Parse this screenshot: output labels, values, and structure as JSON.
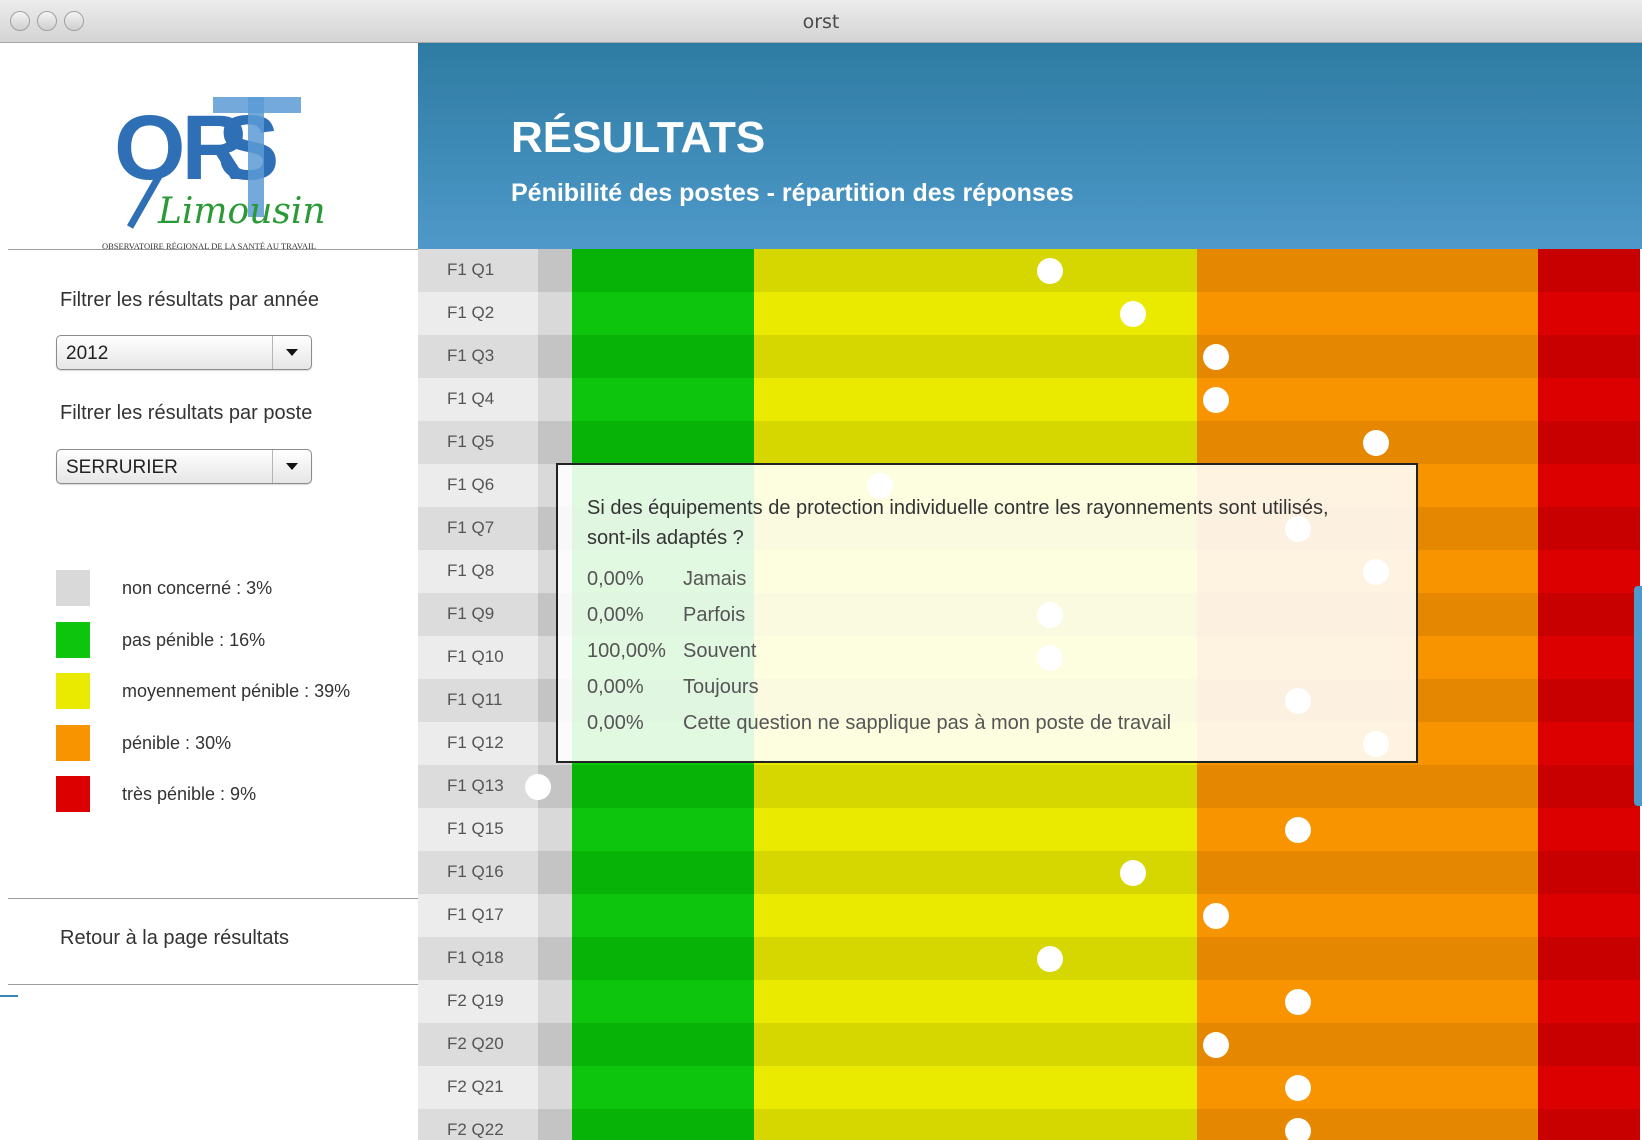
{
  "window": {
    "title": "orst"
  },
  "logo": {
    "letters": "ORST",
    "subtitle": "Limousin",
    "tagline": "Observatoire Régional de la Santé au Travail"
  },
  "sidebar": {
    "year_filter_label": "Filtrer les résultats par année",
    "year_value": "2012",
    "post_filter_label": "Filtrer les résultats par poste",
    "post_value": "SERRURIER",
    "legend": [
      {
        "label": "non concerné : 3%",
        "color": "#d9d9d9"
      },
      {
        "label": "pas pénible : 16%",
        "color": "#0cc50c"
      },
      {
        "label": "moyennement pénible : 39%",
        "color": "#eaea00"
      },
      {
        "label": "pénible : 30%",
        "color": "#f79400"
      },
      {
        "label": "très pénible : 9%",
        "color": "#dc0000"
      }
    ],
    "back_link": "Retour à la page résultats"
  },
  "header": {
    "title": "RÉSULTATS",
    "subtitle": "Pénibilité des postes - répartition des réponses"
  },
  "chart_data": {
    "type": "heatmap",
    "categories_y": [
      "F1 Q1",
      "F1 Q2",
      "F1 Q3",
      "F1 Q4",
      "F1 Q5",
      "F1 Q6",
      "F1 Q7",
      "F1 Q8",
      "F1 Q9",
      "F1 Q10",
      "F1 Q11",
      "F1 Q12",
      "F1 Q13",
      "F1 Q15",
      "F1 Q16",
      "F1 Q17",
      "F1 Q18",
      "F2 Q19",
      "F2 Q20",
      "F2 Q21",
      "F2 Q22"
    ],
    "bands": [
      {
        "name": "non concerné",
        "share": 3,
        "color": "#d9d9d9",
        "color_alt": "#c4c4c4"
      },
      {
        "name": "pas pénible",
        "share": 16,
        "color": "#0cc50c",
        "color_alt": "#07b307"
      },
      {
        "name": "moyennement pénible",
        "share": 39,
        "color": "#eaea00",
        "color_alt": "#d6d600"
      },
      {
        "name": "pénible",
        "share": 30,
        "color": "#f79400",
        "color_alt": "#e58800"
      },
      {
        "name": "très pénible",
        "share": 9,
        "color": "#dc0000",
        "color_alt": "#c80000"
      }
    ],
    "label_colors": {
      "light": "#ececec",
      "dark": "#dcdcdc"
    },
    "scores": [
      46.5,
      54,
      61.5,
      61.5,
      76,
      31,
      69,
      76,
      46.5,
      46.5,
      69,
      76,
      0,
      69,
      54,
      61.5,
      46.5,
      69,
      61.5,
      69,
      69
    ],
    "score_range": [
      0,
      100
    ]
  },
  "tooltip": {
    "question": "Si des équipements de protection individuelle contre les rayonnements sont utilisés, sont-ils adaptés ?",
    "answers": [
      {
        "pct": "0,00%",
        "label": "Jamais"
      },
      {
        "pct": "0,00%",
        "label": "Parfois"
      },
      {
        "pct": "100,00%",
        "label": "Souvent"
      },
      {
        "pct": "0,00%",
        "label": "Toujours"
      },
      {
        "pct": "0,00%",
        "label": "Cette question ne sapplique pas à mon poste de travail"
      }
    ]
  }
}
